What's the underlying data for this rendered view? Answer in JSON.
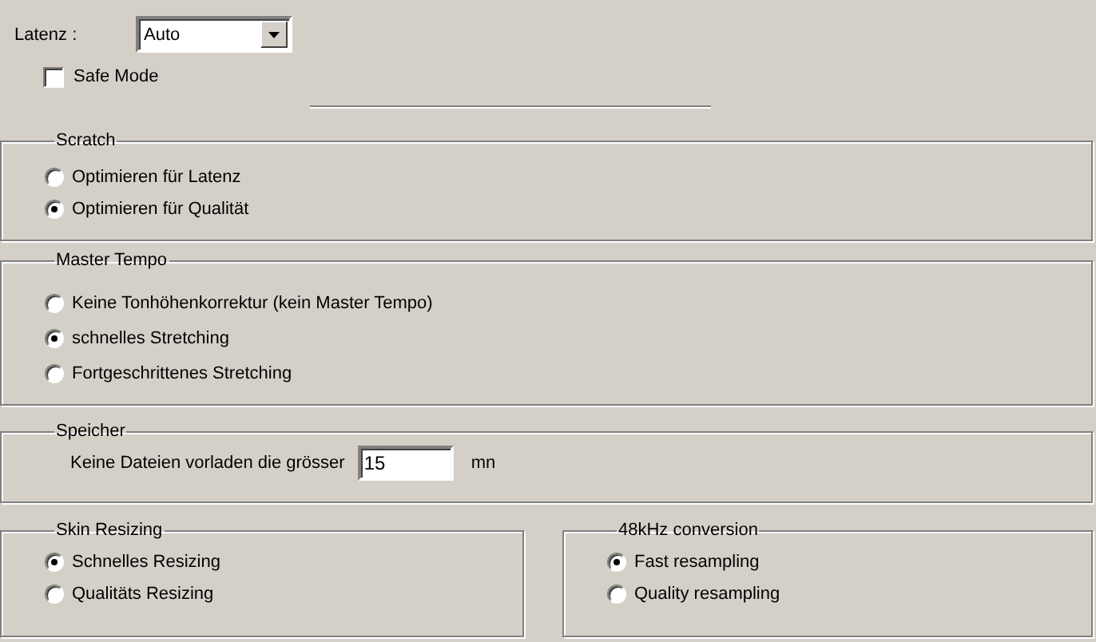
{
  "latency": {
    "label": "Latenz :",
    "value": "Auto"
  },
  "safe_mode": {
    "label": "Safe Mode",
    "checked": false
  },
  "scratch": {
    "title": "Scratch",
    "options": [
      {
        "label": "Optimieren für Latenz",
        "selected": false
      },
      {
        "label": "Optimieren für Qualität",
        "selected": true
      }
    ]
  },
  "master_tempo": {
    "title": "Master Tempo",
    "options": [
      {
        "label": "Keine Tonhöhenkorrektur (kein Master Tempo)",
        "selected": false
      },
      {
        "label": "schnelles Stretching",
        "selected": true
      },
      {
        "label": "Fortgeschrittenes Stretching",
        "selected": false
      }
    ]
  },
  "memory": {
    "title": "Speicher",
    "label": "Keine Dateien vorladen die grösser",
    "value": "15",
    "unit": "mn"
  },
  "skin_resizing": {
    "title": "Skin Resizing",
    "options": [
      {
        "label": "Schnelles Resizing",
        "selected": true
      },
      {
        "label": "Qualitäts Resizing",
        "selected": false
      }
    ]
  },
  "conversion_48khz": {
    "title": "48kHz conversion",
    "options": [
      {
        "label": "Fast resampling",
        "selected": true
      },
      {
        "label": "Quality resampling",
        "selected": false
      }
    ]
  }
}
